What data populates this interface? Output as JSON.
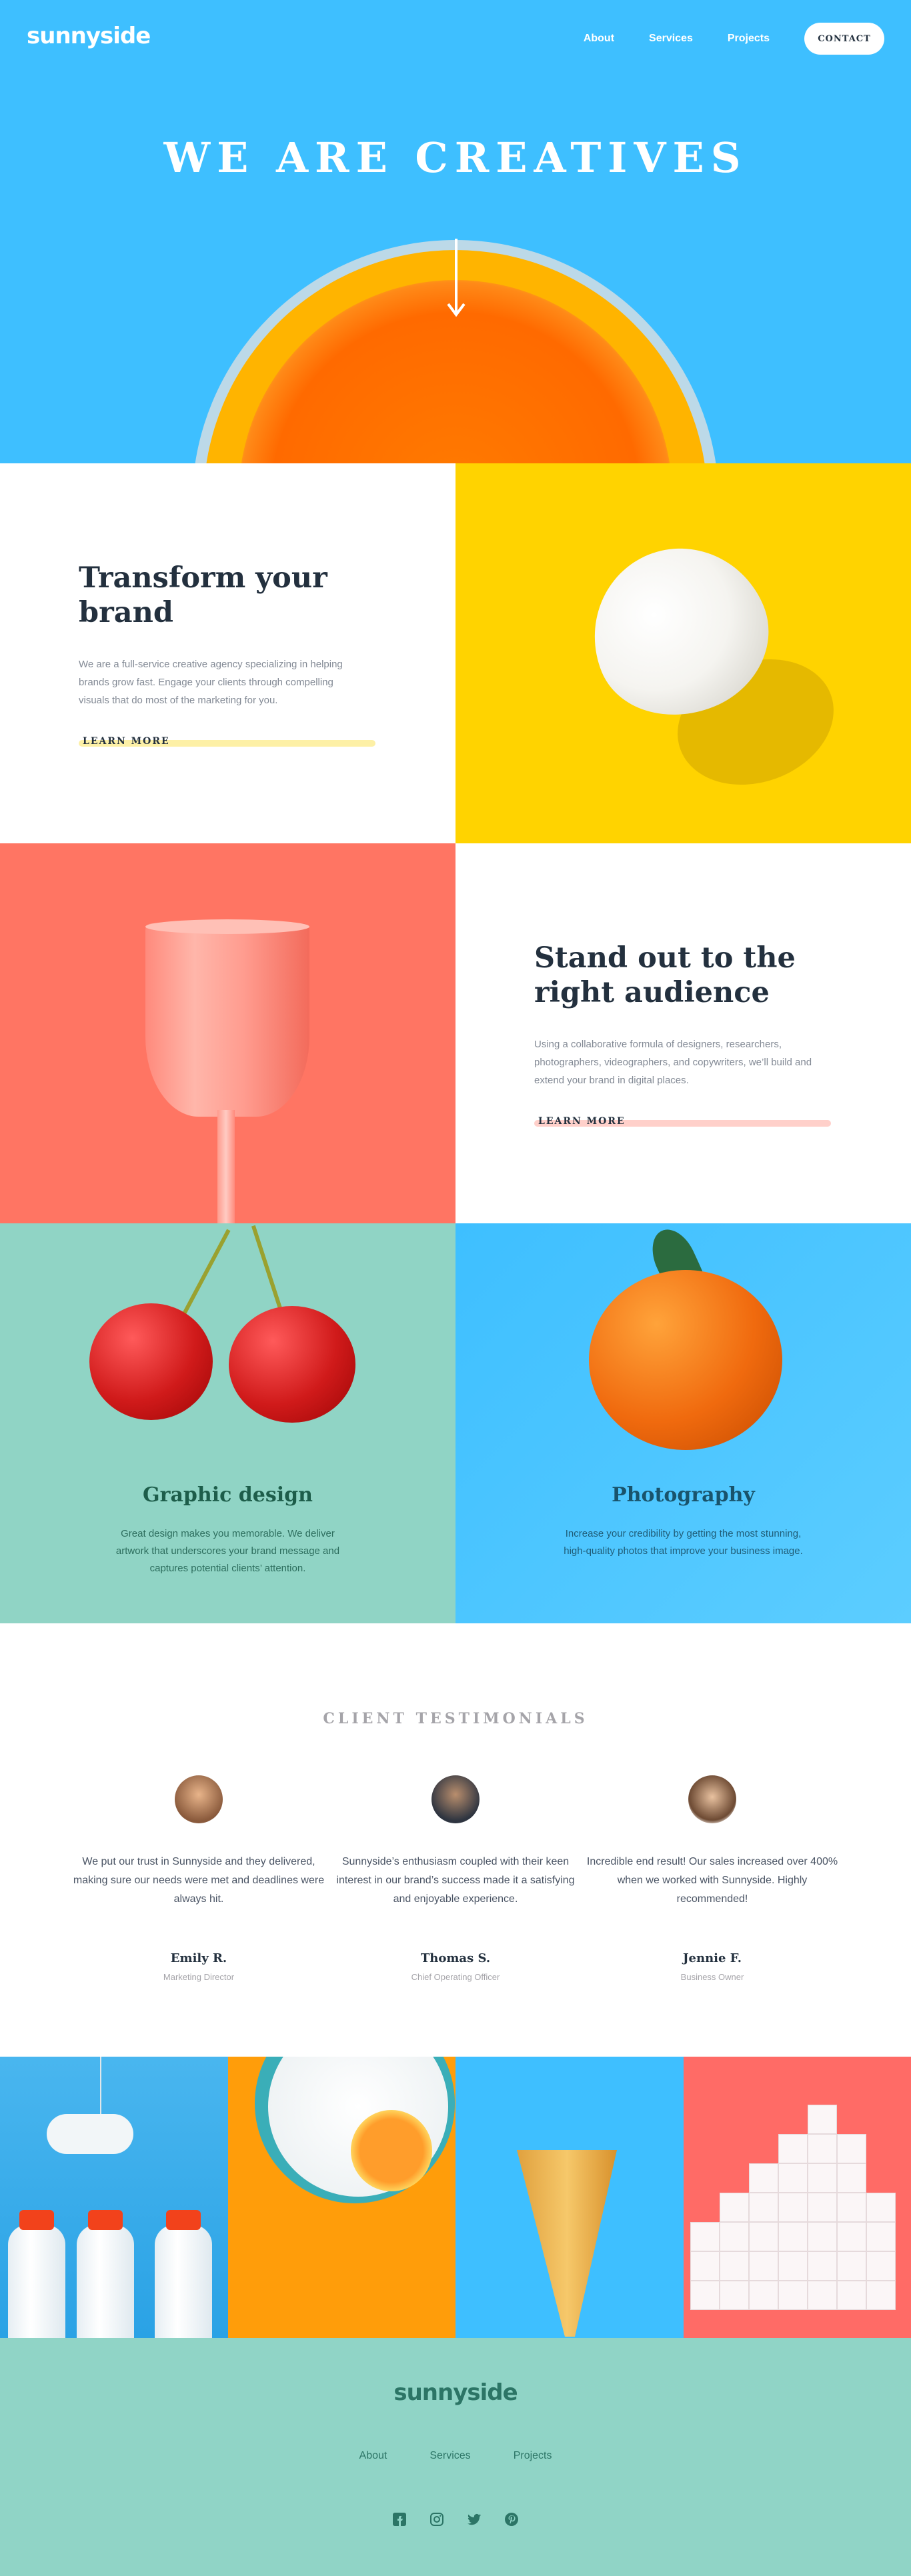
{
  "header": {
    "logo": "sunnyside",
    "nav": [
      "About",
      "Services",
      "Projects"
    ],
    "contact_label": "CONTACT"
  },
  "hero": {
    "title": "WE ARE CREATIVES",
    "arrow_icon": "arrow-down-icon"
  },
  "features": [
    {
      "title": "Transform your brand",
      "description": "We are a full-service creative agency specializing in helping brands grow fast. Engage your clients through compelling visuals that do most of the marketing for you.",
      "link": "LEARN MORE",
      "accent": "#fad400"
    },
    {
      "title": "Stand out to the right audience",
      "description": "Using a collaborative formula of designers, researchers, photographers, videographers, and copywriters, we’ll build and extend your brand in digital places.",
      "link": "LEARN MORE",
      "accent": "#fe7766"
    }
  ],
  "services": [
    {
      "title": "Graphic design",
      "description": "Great design makes you memorable. We deliver artwork that underscores your brand message and captures potential clients’ attention."
    },
    {
      "title": "Photography",
      "description": "Increase your credibility by getting the most stunning, high-quality photos that improve your business image."
    }
  ],
  "testimonials": {
    "heading": "CLIENT TESTIMONIALS",
    "items": [
      {
        "quote": "We put our trust in Sunnyside and they delivered, making sure our needs were met and deadlines were always hit.",
        "name": "Emily R.",
        "role": "Marketing Director"
      },
      {
        "quote": "Sunnyside’s enthusiasm coupled with their keen interest in our brand’s success made it a satisfying and enjoyable experience.",
        "name": "Thomas S.",
        "role": "Chief Operating Officer"
      },
      {
        "quote": "Incredible end result! Our sales increased over 400% when we worked with Sunnyside. Highly recommended!",
        "name": "Jennie F.",
        "role": "Business Owner"
      }
    ]
  },
  "footer": {
    "logo": "sunnyside",
    "nav": [
      "About",
      "Services",
      "Projects"
    ],
    "socials": [
      "facebook-icon",
      "instagram-icon",
      "twitter-icon",
      "pinterest-icon"
    ]
  },
  "colors": {
    "hero_blue": "#3ebfff",
    "yellow": "#ffd300",
    "coral": "#ff7563",
    "mint": "#90d4c5",
    "footer_text": "#2c7566"
  }
}
